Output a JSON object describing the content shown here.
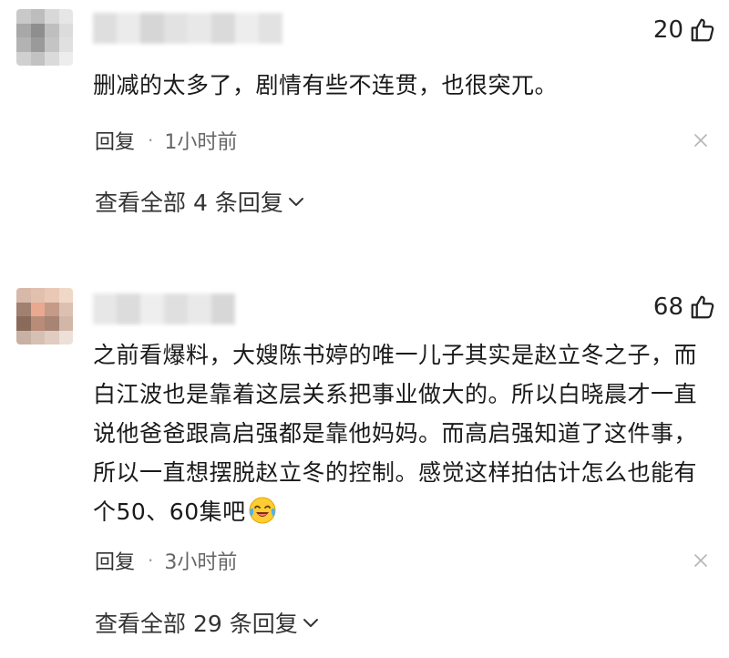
{
  "comments": [
    {
      "likes": "20",
      "text": "删减的太多了，剧情有些不连贯，也很突兀。",
      "reply_label": "回复",
      "separator": "·",
      "time": "1小时前",
      "view_replies": "查看全部 4 条回复"
    },
    {
      "likes": "68",
      "text": "之前看爆料，大嫂陈书婷的唯一儿子其实是赵立冬之子，而白江波也是靠着这层关系把事业做大的。所以白晓晨才一直说他爸爸跟高启强都是靠他妈妈。而高启强知道了这件事，所以一直想摆脱赵立冬的控制。感觉这样拍估计怎么也能有个50、60集吧",
      "emoji": "laughing-crying-emoji",
      "reply_label": "回复",
      "separator": "·",
      "time": "3小时前",
      "view_replies": "查看全部 29 条回复"
    }
  ],
  "icons": {
    "like": "thumbs-up-icon",
    "close": "close-icon",
    "expand": "chevron-down-icon"
  },
  "colors": {
    "text": "#1a1a1a",
    "meta": "#666666",
    "background": "#ffffff"
  }
}
